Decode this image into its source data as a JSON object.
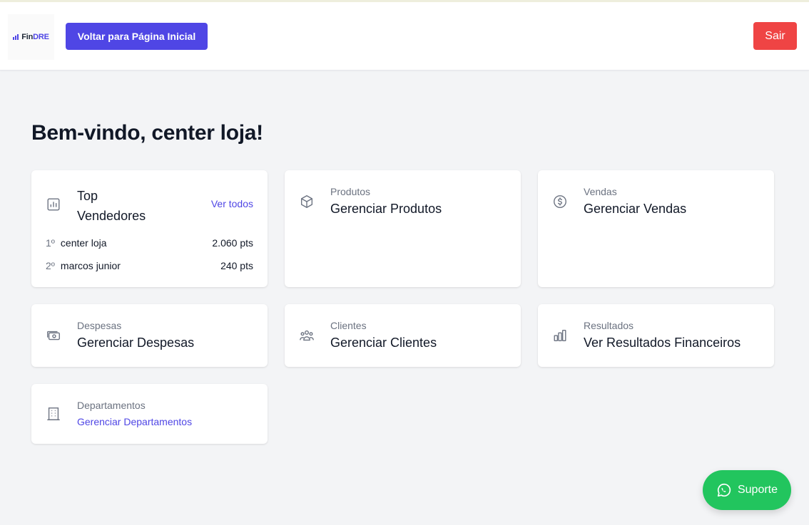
{
  "header": {
    "logo": {
      "fin": "Fin",
      "dre": "DRE"
    },
    "home_button": "Voltar para Página Inicial",
    "logout_button": "Sair"
  },
  "welcome": "Bem-vindo, center loja!",
  "top_sellers": {
    "title_line1": "Top",
    "title_line2": "Vendedores",
    "see_all": "Ver todos",
    "icon": "bar-chart-icon",
    "ranking": [
      {
        "position": "1º",
        "name": "center loja",
        "points": "2.060 pts"
      },
      {
        "position": "2º",
        "name": "marcos junior",
        "points": "240 pts"
      }
    ]
  },
  "cards": {
    "produtos": {
      "label": "Produtos",
      "title": "Gerenciar Produtos",
      "icon": "cube-icon"
    },
    "vendas": {
      "label": "Vendas",
      "title": "Gerenciar Vendas",
      "icon": "dollar-circle-icon"
    },
    "despesas": {
      "label": "Despesas",
      "title": "Gerenciar Despesas",
      "icon": "cash-icon"
    },
    "clientes": {
      "label": "Clientes",
      "title": "Gerenciar Clientes",
      "icon": "users-icon"
    },
    "resultados": {
      "label": "Resultados",
      "title": "Ver Resultados Financeiros",
      "icon": "chart-bar-icon"
    },
    "departamentos": {
      "label": "Departamentos",
      "title": "Gerenciar Departamentos",
      "icon": "building-icon"
    }
  },
  "support": {
    "label": "Suporte",
    "icon": "whatsapp-icon"
  },
  "colors": {
    "primary": "#4f46e5",
    "danger": "#ef4444",
    "success": "#22c55e",
    "background": "#f3f4f6",
    "muted_text": "#6b7280"
  }
}
